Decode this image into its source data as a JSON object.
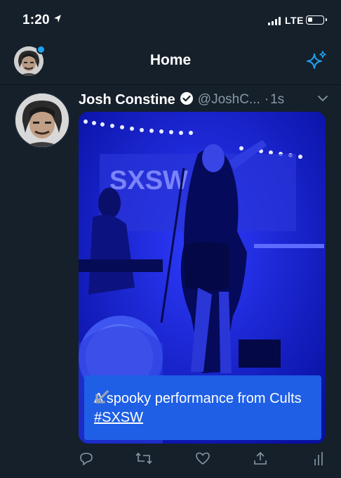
{
  "status_bar": {
    "time": "1:20",
    "network": "LTE"
  },
  "nav": {
    "title": "Home"
  },
  "tweet": {
    "display_name": "Josh Constine",
    "handle": "@JoshC...",
    "separator": "·",
    "time_ago": "1s",
    "caption_text": "A spooky performance from Cults ",
    "hashtag": "#SXSW",
    "media_banner_text": "SXSW"
  },
  "icons": {
    "location": "location-arrow-icon",
    "signal": "cellular-signal-icon",
    "battery": "battery-icon",
    "sparkle": "sparkle-icon",
    "verified": "verified-badge-icon",
    "chevron": "chevron-down-icon",
    "expand": "expand-arrow-icon",
    "reply": "reply-icon",
    "retweet": "retweet-icon",
    "like": "like-icon",
    "share": "share-icon",
    "analytics": "analytics-icon"
  },
  "colors": {
    "background": "#15202b",
    "accent": "#1da1f2",
    "secondary_text": "#8899a6",
    "media_blue": "#0a14b8",
    "caption_blue": "#1e5fe6"
  }
}
